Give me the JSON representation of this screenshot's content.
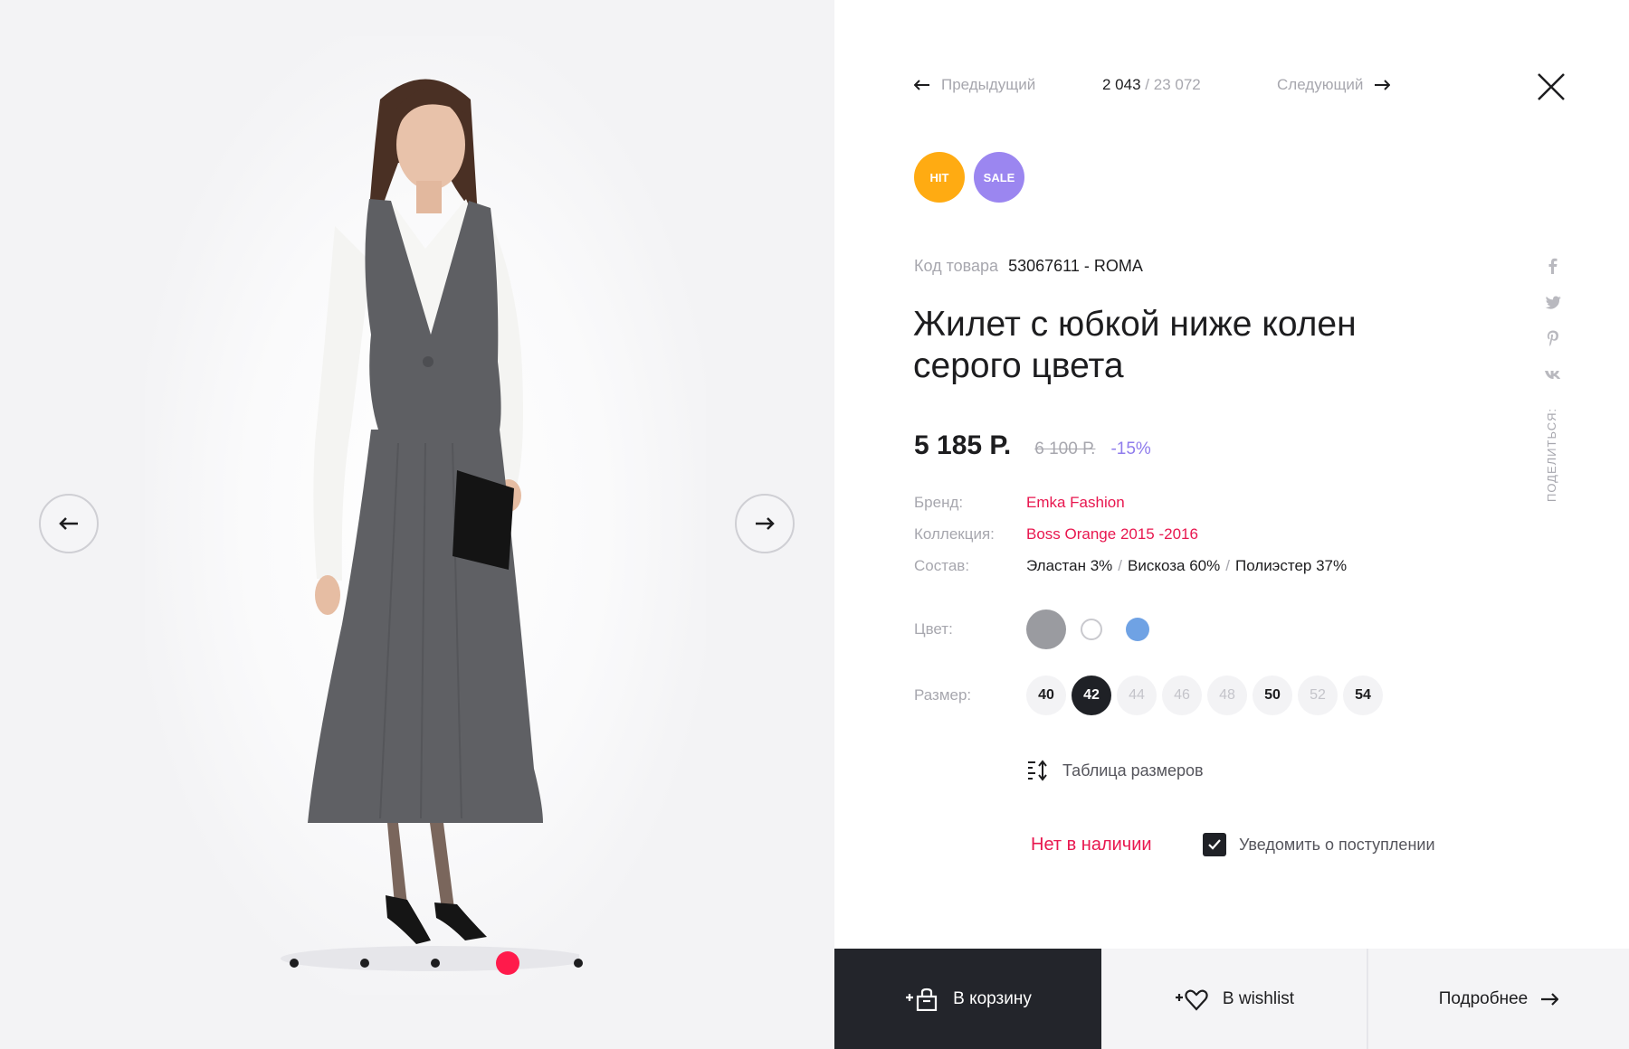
{
  "navigation": {
    "prev_label": "Предыдущий",
    "next_label": "Следующий",
    "current": "2 043",
    "separator": "/",
    "total": "23 072"
  },
  "badges": {
    "hit": "HIT",
    "sale": "SALE"
  },
  "product": {
    "sku_label": "Код товара",
    "sku": "53067611 - ROMA",
    "title": "Жилет с юбкой ниже колен серого цвета",
    "price": "5 185 Р.",
    "old_price": "6 100 Р.",
    "discount": "-15%"
  },
  "properties": {
    "brand_label": "Бренд:",
    "brand": "Emka Fashion",
    "collection_label": "Коллекция:",
    "collection": "Boss Orange 2015 -2016",
    "composition_label": "Состав:",
    "composition": [
      "Эластан 3%",
      "Вискоза 60%",
      "Полиэстер 37%"
    ],
    "composition_separator": "/"
  },
  "color": {
    "label": "Цвет:",
    "options": [
      {
        "name": "gray",
        "hex": "#9a9ba0",
        "selected": true
      },
      {
        "name": "white",
        "hex": "#ffffff",
        "selected": false
      },
      {
        "name": "blue",
        "hex": "#6fa2e4",
        "selected": false
      }
    ]
  },
  "size": {
    "label": "Размер:",
    "options": [
      {
        "value": "40",
        "state": "available"
      },
      {
        "value": "42",
        "state": "selected"
      },
      {
        "value": "44",
        "state": "disabled"
      },
      {
        "value": "46",
        "state": "disabled"
      },
      {
        "value": "48",
        "state": "disabled"
      },
      {
        "value": "50",
        "state": "available"
      },
      {
        "value": "52",
        "state": "disabled"
      },
      {
        "value": "54",
        "state": "available"
      }
    ],
    "table_label": "Таблица размеров"
  },
  "stock": {
    "status": "Нет в наличии",
    "notify_label": "Уведомить о поступлении",
    "notify_checked": true
  },
  "share": {
    "label": "ПОДЕЛИТЬСЯ:",
    "icons": [
      "facebook-icon",
      "twitter-icon",
      "pinterest-icon",
      "vk-icon"
    ]
  },
  "gallery": {
    "slides": 5,
    "active_index": 3
  },
  "actions": {
    "cart_label": "В корзину",
    "wishlist_label": "В wishlist",
    "more_label": "Подробнее"
  },
  "colors": {
    "accent_pink": "#e8174f",
    "dot_active": "#ff1a4b",
    "hit": "#ffab12",
    "sale": "#9b86f0",
    "discount": "#8f7cec",
    "dark": "#23252b"
  }
}
